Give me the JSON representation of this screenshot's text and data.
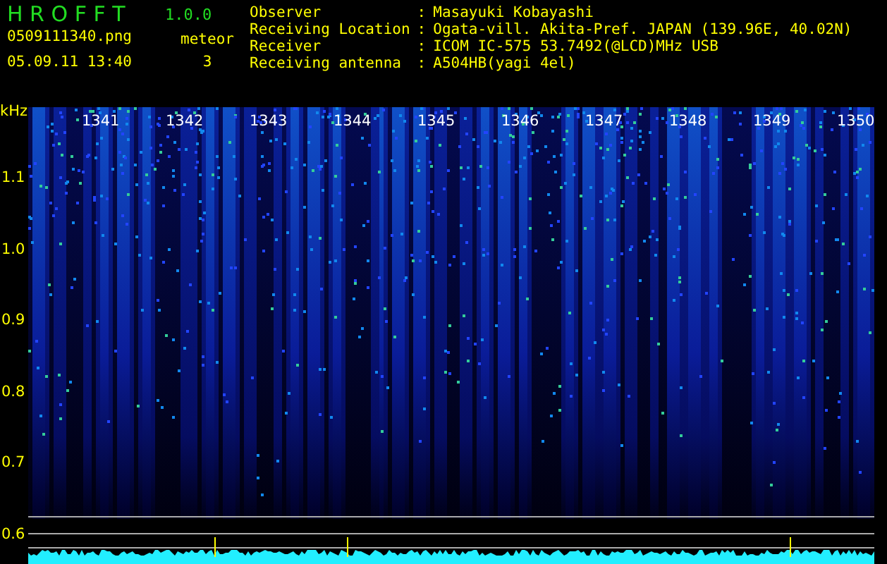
{
  "app": {
    "name": "H R O F F T",
    "version": "1.0.0"
  },
  "file": {
    "name": "0509111340.png",
    "datetime": "05.09.11 13:40"
  },
  "meteor": {
    "label": "meteor",
    "count": "3"
  },
  "info": [
    {
      "label": "Observer",
      "separator": ":",
      "value": "Masayuki Kobayashi"
    },
    {
      "label": "Receiving Location",
      "separator": ":",
      "value": "Ogata-vill. Akita-Pref. JAPAN (139.96E, 40.02N)"
    },
    {
      "label": "Receiver",
      "separator": ":",
      "value": "ICOM IC-575 53.7492(@LCD)MHz USB"
    },
    {
      "label": "Receiving antenna",
      "separator": ":",
      "value": "A504HB(yagi 4el)"
    }
  ],
  "spectrogram": {
    "unit": "kHz",
    "frequency_labels": [
      "1.1",
      "1.0",
      "0.9",
      "0.8",
      "0.7",
      "0.6"
    ],
    "time_labels": [
      "1341",
      "1342",
      "1343",
      "1344",
      "1345",
      "1346",
      "1347",
      "1348",
      "1349",
      "1350"
    ]
  }
}
